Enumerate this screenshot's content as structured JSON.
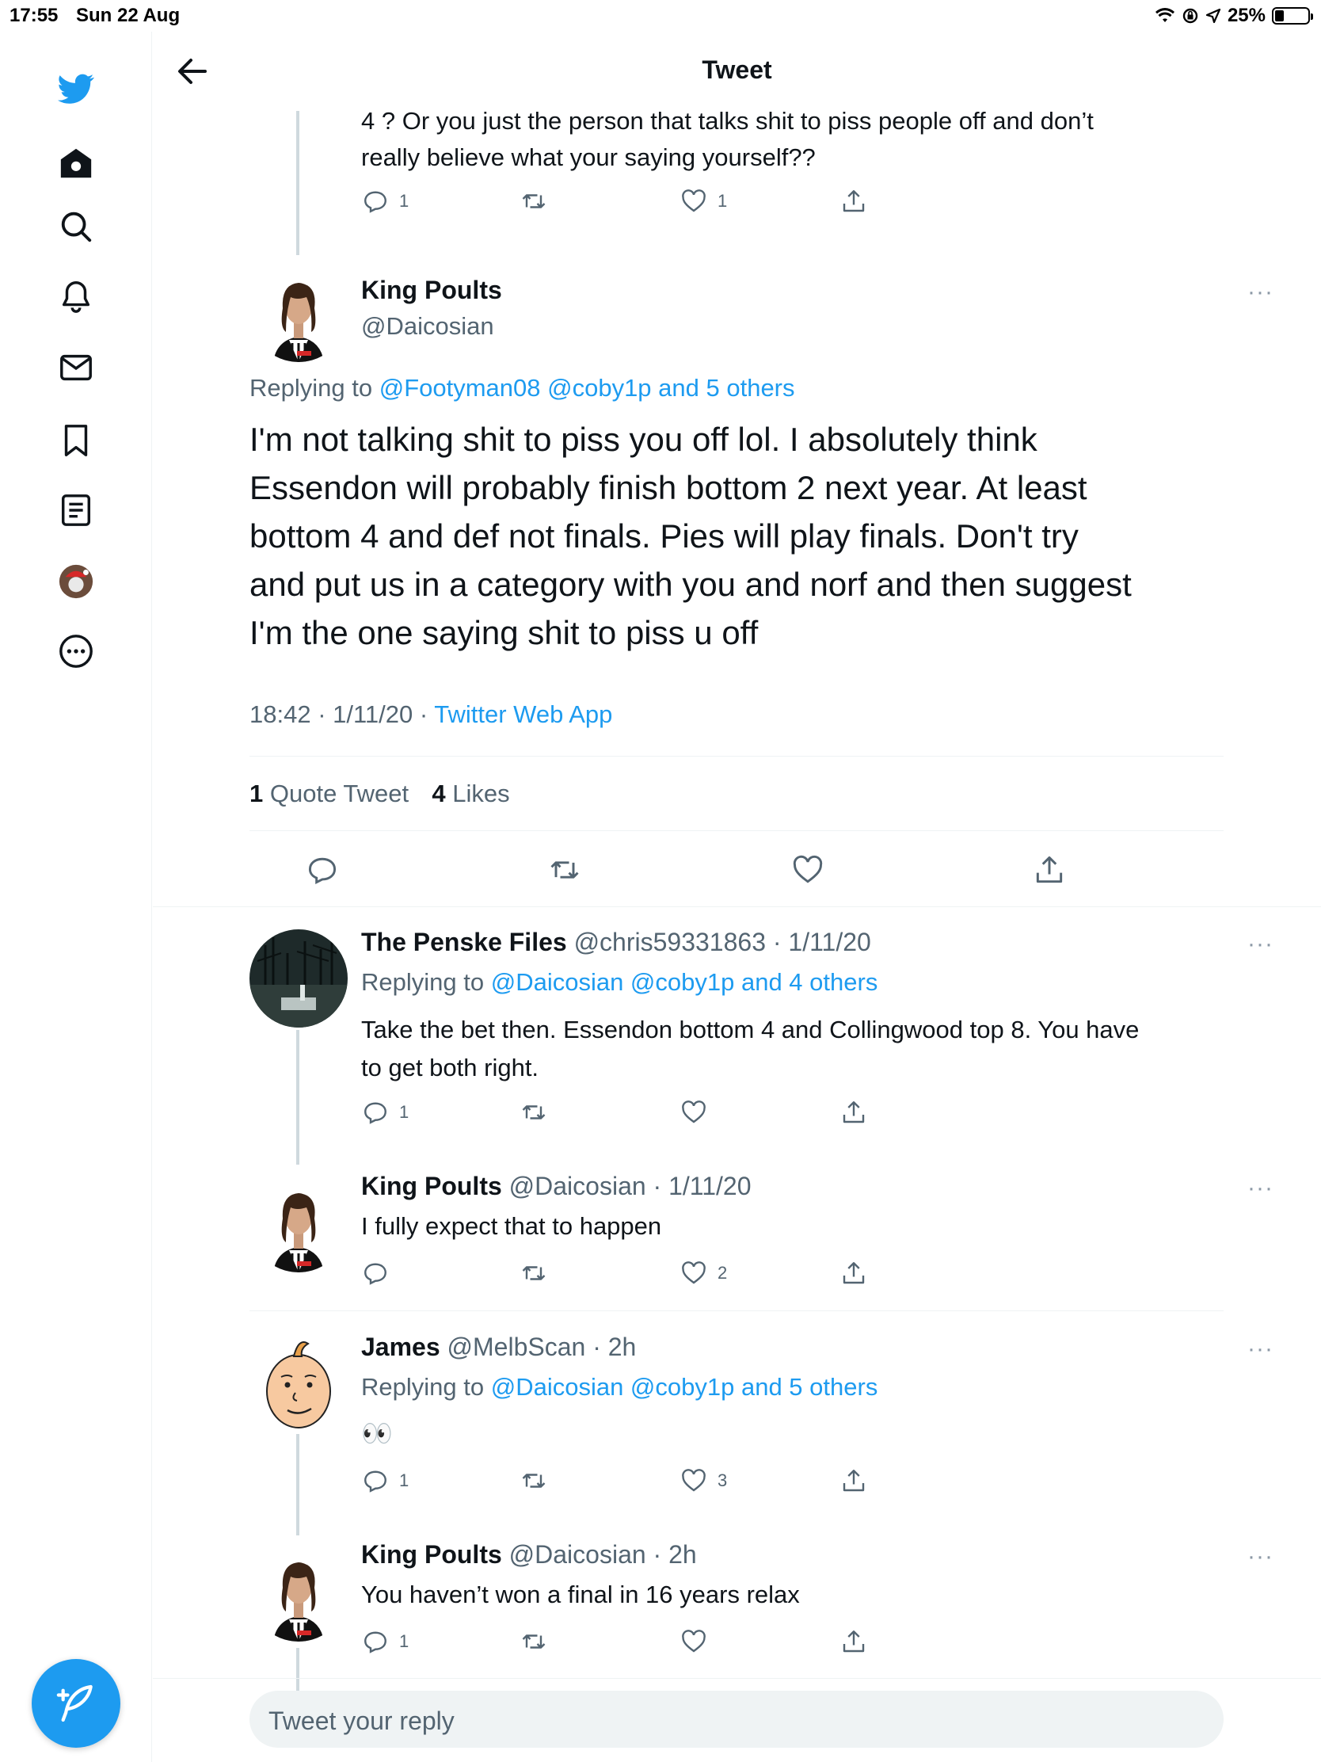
{
  "status_bar": {
    "time": "17:55",
    "date": "Sun 22 Aug",
    "battery": "25%"
  },
  "header": {
    "title": "Tweet"
  },
  "top_tweet_tail": {
    "text_line1": "4 ? Or you just the person that talks shit to piss people off and don’t",
    "text_line2": "really believe what your saying yourself??",
    "reply_count": "1",
    "like_count": "1"
  },
  "main_tweet": {
    "name": "King Poults",
    "handle": "@Daicosian",
    "replying_label": "Replying to",
    "replying_to": "@Footyman08 @coby1p and 5 others",
    "text_lines": [
      "I'm not talking shit to piss you off lol. I absolutely think",
      "Essendon will probably finish bottom 2 next year. At least",
      "bottom 4 and def not finals. Pies will play finals. Don't try",
      "and put us in a category with you and norf and then suggest",
      "I'm the one saying shit to piss u off"
    ],
    "time": "18:42 · 1/11/20 ·",
    "source": "Twitter Web App",
    "quote_count": "1",
    "quote_label": "Quote Tweet",
    "like_count": "4",
    "like_label": "Likes"
  },
  "replies": [
    {
      "name": "The Penske Files",
      "handle_time": "@chris59331863 · 1/11/20",
      "replying_label": "Replying to",
      "replying_to": "@Daicosian @coby1p and 4 others",
      "text_line1": "Take the bet then. Essendon bottom 4 and Collingwood top 8. You have",
      "text_line2": "to get both right.",
      "reply_count": "1",
      "like_count": ""
    },
    {
      "name": "King Poults",
      "handle_time": "@Daicosian · 1/11/20",
      "text_line1": "I fully expect that to happen",
      "reply_count": "",
      "like_count": "2"
    },
    {
      "name": "James",
      "handle_time": "@MelbScan · 2h",
      "replying_label": "Replying to",
      "replying_to": "@Daicosian @coby1p and 5 others",
      "text_line1": "👀",
      "reply_count": "1",
      "like_count": "3"
    },
    {
      "name": "King Poults",
      "handle_time": "@Daicosian · 2h",
      "text_line1": "You haven’t won a final in 16 years relax",
      "reply_count": "1",
      "like_count": ""
    }
  ],
  "reply_box": {
    "placeholder": "Tweet your reply"
  },
  "more_label": "···"
}
